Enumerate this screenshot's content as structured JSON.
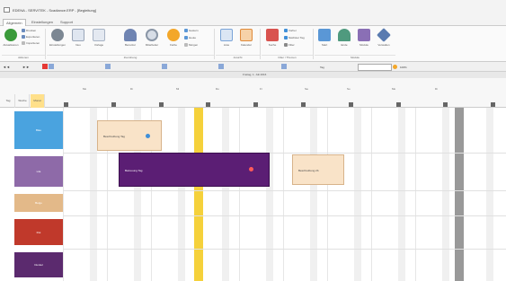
{
  "window": {
    "title": "EDENA - SERVITEK - Scadiance.ERP - [Begleitung]"
  },
  "tabs": [
    {
      "label": "Allgemein",
      "active": true
    },
    {
      "label": "Einstellungen",
      "active": false
    },
    {
      "label": "Support",
      "active": false
    }
  ],
  "ribbon": {
    "aktualisieren": "Aktualisieren",
    "smallA": [
      "Drucken",
      "Exportieren",
      "Importieren"
    ],
    "groups": [
      {
        "label": "Aktionen"
      },
      {
        "label": "Zuordnung"
      },
      {
        "label": "Ansicht"
      },
      {
        "label": "Filter / Themen"
      },
      {
        "label": "Module"
      }
    ],
    "buttons": [
      {
        "label": "Einstellungen",
        "icon": "gear-icon",
        "color": "#7c8793"
      },
      {
        "label": "Neu",
        "icon": "document-icon",
        "color": "#9aa6b8"
      },
      {
        "label": "Vorlage",
        "icon": "template-icon",
        "color": "#a7b3c4"
      },
      {
        "label": "Benutzer",
        "icon": "person-icon",
        "color": "#6f84b2"
      },
      {
        "label": "Mitarbeiter",
        "icon": "magnifier-icon",
        "color": "#8a96a6"
      },
      {
        "label": "Farbe",
        "icon": "palette-icon",
        "color": "#f3a72a"
      },
      {
        "label": "Liste",
        "icon": "list-icon",
        "color": "#7aa4d8"
      },
      {
        "label": "Kalender",
        "icon": "calendar-icon",
        "color": "#e08a3a"
      },
      {
        "label": "Suche",
        "icon": "book-icon",
        "color": "#d9534f"
      },
      {
        "label": "Start",
        "icon": "box-icon",
        "color": "#5a97d6"
      },
      {
        "label": "Ende",
        "icon": "home-icon",
        "color": "#4f9a7e"
      },
      {
        "label": "Module",
        "icon": "module-icon",
        "color": "#8a6fb5"
      },
      {
        "label": "Verwalten",
        "icon": "tools-icon",
        "color": "#5a7bb0"
      }
    ],
    "smallB": [
      "Gestern",
      "Heute",
      "Morgen"
    ],
    "smallC": [
      "Vorher",
      "Nächster Tag",
      "Filter"
    ]
  },
  "nav": {
    "prev": "◄◄",
    "next": "►►",
    "months": "Jan Feb Mär Apr Mai Jun Jul Aug Sep Okt Nov Dez",
    "mode": "Tag",
    "zoom": "100%"
  },
  "range": "Freitag, 1. Juli 2016",
  "viewButtons": [
    "Tag",
    "Woche",
    "Monat"
  ],
  "dayLabels": [
    "Mo",
    "Di",
    "Mi",
    "Do",
    "Fr",
    "Sa",
    "So",
    "Mo",
    "Di"
  ],
  "lanes": [
    {
      "label": "Blau",
      "color": "#4aa3df"
    },
    {
      "label": "Lila",
      "color": "#8e6aa8"
    },
    {
      "label": "Beige",
      "color": "#e3b989"
    },
    {
      "label": "Rot",
      "color": "#c0392b"
    },
    {
      "label": "Dunkel",
      "color": "#5b2a6e"
    }
  ],
  "appointments": [
    {
      "label": "Beschreibung Tag",
      "bg": "#f9e3c8",
      "border": "#d7b38a",
      "fg": "#444",
      "dot": "#3f8fd8"
    },
    {
      "label": "Betreuung Tag",
      "bg": "#5b1e74",
      "border": "#3c0f4f",
      "fg": "#fff",
      "dot": "#ff5a5a"
    },
    {
      "label": "Beschreibung 2b",
      "bg": "#f9e3c8",
      "border": "#d7b38a",
      "fg": "#444",
      "dot": null
    }
  ],
  "colors": {
    "today": "#f5d13b",
    "accent": "#e53935",
    "weekSel": "#8aa8d8"
  }
}
